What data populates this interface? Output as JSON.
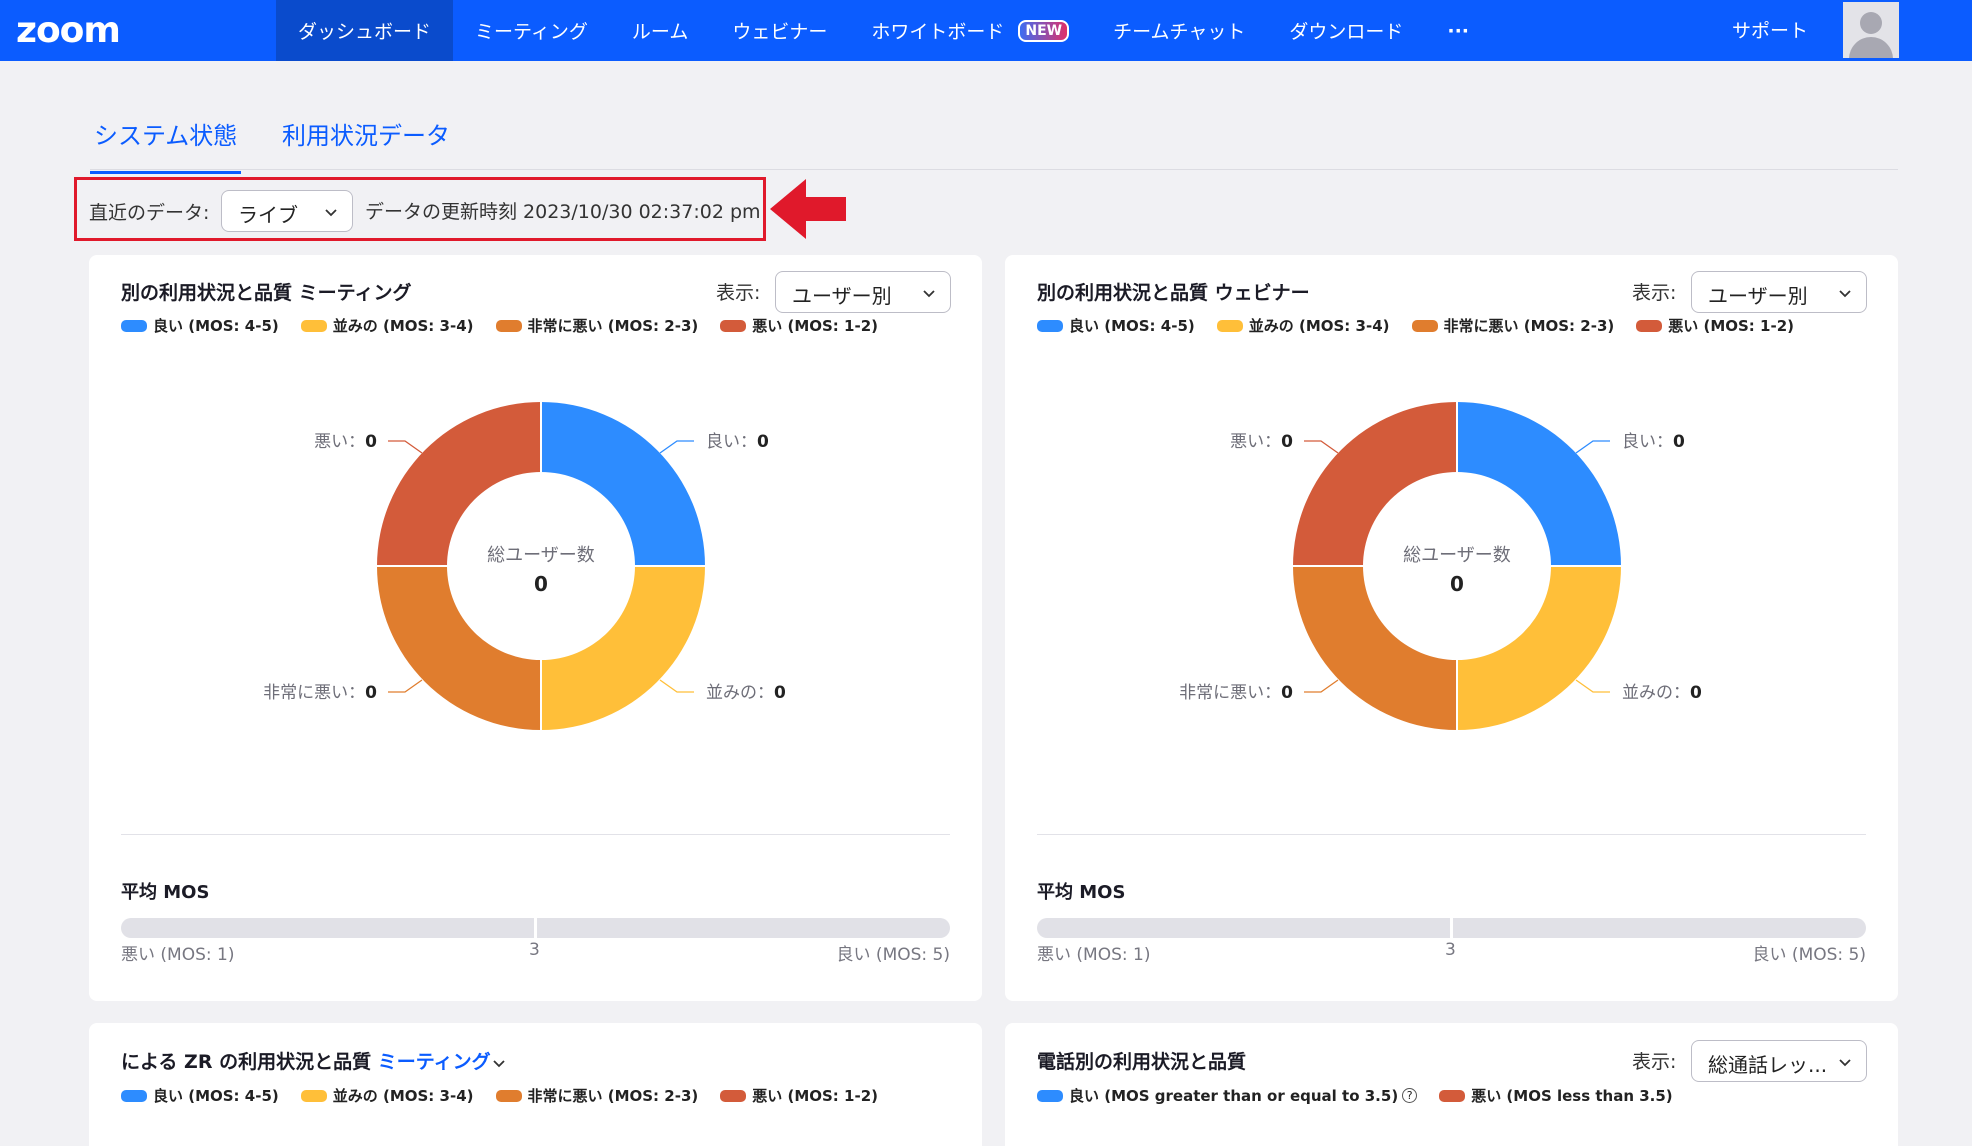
{
  "nav": {
    "logo": "zoom",
    "items": [
      {
        "label": "ダッシュボード",
        "active": true
      },
      {
        "label": "ミーティング"
      },
      {
        "label": "ルーム"
      },
      {
        "label": "ウェビナー"
      },
      {
        "label": "ホワイトボード",
        "badge": "NEW"
      },
      {
        "label": "チームチャット"
      },
      {
        "label": "ダウンロード"
      },
      {
        "label": "···"
      }
    ],
    "support": "サポート"
  },
  "tabs": [
    {
      "label": "システム状態",
      "active": true
    },
    {
      "label": "利用状況データ"
    }
  ],
  "recent": {
    "label": "直近のデータ:",
    "select_value": "ライブ",
    "updated": "データの更新時刻 2023/10/30 02:37:02 pm"
  },
  "colors": {
    "good": "#2d8cff",
    "fair": "#ffbf39",
    "poor": "#e07d2e",
    "bad": "#d35b3a",
    "accent": "#0b5cff",
    "highlight": "#e0192b"
  },
  "legend": {
    "good": "良い (MOS: 4-5)",
    "fair": "並みの (MOS: 3-4)",
    "poor": "非常に悪い (MOS: 2-3)",
    "bad": "悪い (MOS: 1-2)"
  },
  "cards": {
    "meeting": {
      "title": "別の利用状況と品質 ミーティング",
      "show_label": "表示:",
      "show_value": "ユーザー別",
      "center_label": "総ユーザー数",
      "center_value": "0",
      "labels": {
        "good": "良い：",
        "fair": "並みの：",
        "poor": "非常に悪い：",
        "bad": "悪い："
      },
      "values": {
        "good": "0",
        "fair": "0",
        "poor": "0",
        "bad": "0"
      },
      "avg_title": "平均 MOS",
      "mos_low": "悪い (MOS: 1)",
      "mos_mid": "3",
      "mos_high": "良い (MOS: 5)"
    },
    "webinar": {
      "title": "別の利用状況と品質 ウェビナー",
      "show_label": "表示:",
      "show_value": "ユーザー別",
      "center_label": "総ユーザー数",
      "center_value": "0",
      "labels": {
        "good": "良い：",
        "fair": "並みの：",
        "poor": "非常に悪い：",
        "bad": "悪い："
      },
      "values": {
        "good": "0",
        "fair": "0",
        "poor": "0",
        "bad": "0"
      },
      "avg_title": "平均 MOS",
      "mos_low": "悪い (MOS: 1)",
      "mos_mid": "3",
      "mos_high": "良い (MOS: 5)"
    },
    "zr": {
      "title_prefix": "による ZR の利用状況と品質",
      "title_link": "ミーティング"
    },
    "phone": {
      "title": "電話別の利用状況と品質",
      "show_label": "表示:",
      "show_value": "総通話レッ...",
      "legend_good": "良い (MOS greater than or equal to 3.5)",
      "help": "?",
      "legend_bad": "悪い (MOS less than 3.5)"
    }
  }
}
